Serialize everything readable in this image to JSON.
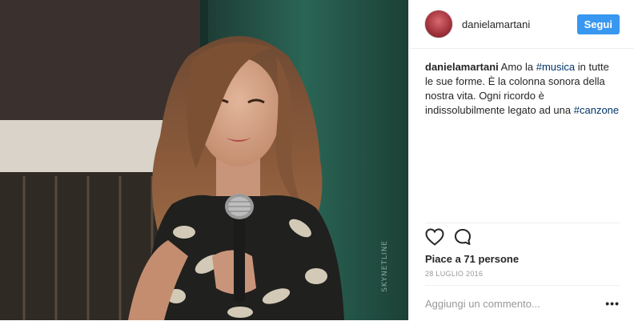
{
  "header": {
    "username": "danielamartani",
    "follow_label": "Segui"
  },
  "caption": {
    "username": "danielamartani",
    "text_1": " Amo la ",
    "tag_1": "#musica",
    "text_2": " in tutte le sue forme. È la colonna sonora della nostra vita. Ogni ricordo è indissolubilmente legato ad una ",
    "tag_2": "#canzone"
  },
  "actions": {
    "like_icon": "heart-outline-icon",
    "comment_icon": "speech-bubble-icon"
  },
  "likes_text": "Piace a 71 persone",
  "date": "28 LUGLIO 2016",
  "comment": {
    "placeholder": "Aggiungi un commento...",
    "more_label": "•••"
  },
  "photo": {
    "watermark": "SKYNETLINE"
  },
  "colors": {
    "follow_bg": "#3897f0",
    "hashtag": "#003569",
    "photo_wall": "#2b6a5a"
  }
}
